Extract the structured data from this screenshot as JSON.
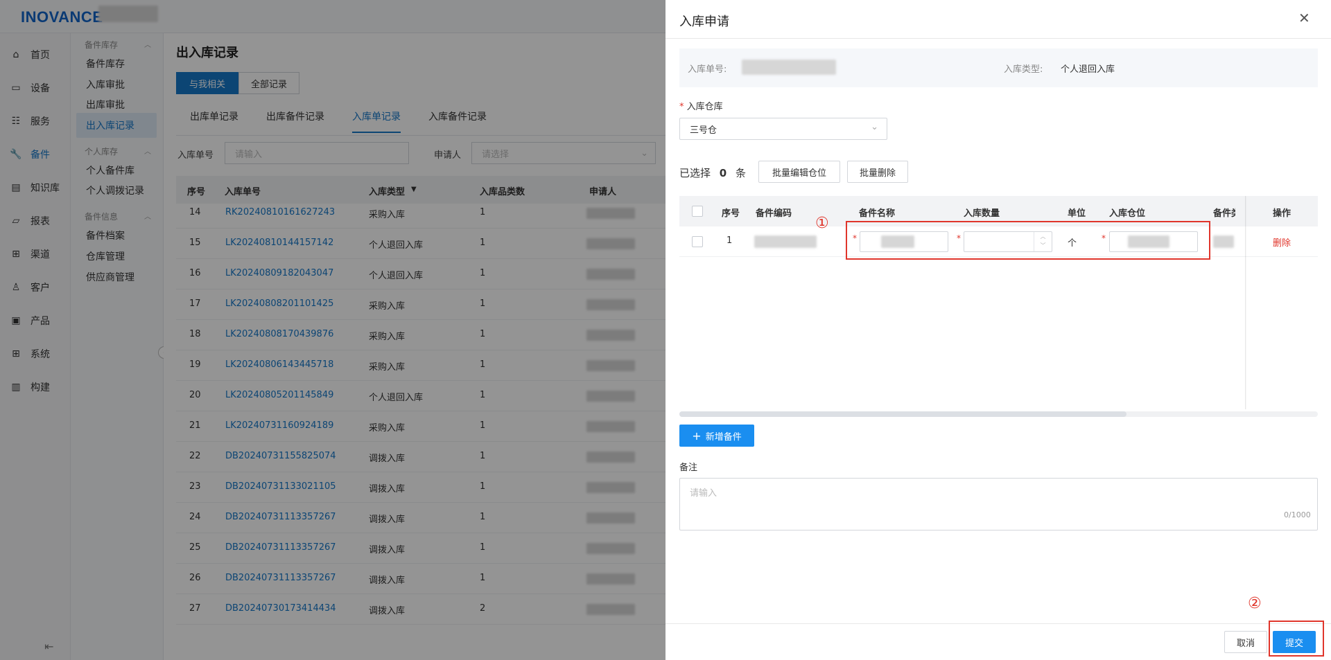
{
  "app": {
    "logo": "INOVANCE"
  },
  "nav_main": [
    {
      "label": "首页",
      "icon": "home-icon",
      "active": false
    },
    {
      "label": "设备",
      "icon": "device-icon",
      "active": false
    },
    {
      "label": "服务",
      "icon": "service-icon",
      "active": false
    },
    {
      "label": "备件",
      "icon": "wrench-icon",
      "active": true
    },
    {
      "label": "知识库",
      "icon": "book-icon",
      "active": false
    },
    {
      "label": "报表",
      "icon": "chart-icon",
      "active": false
    },
    {
      "label": "渠道",
      "icon": "channel-icon",
      "active": false
    },
    {
      "label": "客户",
      "icon": "user-icon",
      "active": false
    },
    {
      "label": "产品",
      "icon": "product-icon",
      "active": false
    },
    {
      "label": "系统",
      "icon": "grid-icon",
      "active": false
    },
    {
      "label": "构建",
      "icon": "build-icon",
      "active": false
    }
  ],
  "nav_sub": {
    "group1": "备件库存",
    "group1_items": [
      "备件库存",
      "入库审批",
      "出库审批",
      "出入库记录"
    ],
    "group2": "个人库存",
    "group2_items": [
      "个人备件库",
      "个人调拨记录"
    ],
    "group3": "备件信息",
    "group3_items": [
      "备件档案",
      "仓库管理",
      "供应商管理"
    ]
  },
  "page": {
    "title": "出入库记录",
    "seg_mine": "与我相关",
    "seg_all": "全部记录",
    "tabs": [
      "出库单记录",
      "出库备件记录",
      "入库单记录",
      "入库备件记录"
    ],
    "active_tab": 2,
    "filter_order_label": "入库单号",
    "filter_order_placeholder": "请输入",
    "filter_applicant_label": "申请人",
    "filter_applicant_placeholder": "请选择"
  },
  "table": {
    "headers": [
      "序号",
      "入库单号",
      "入库类型",
      "入库品类数",
      "申请人"
    ],
    "rows": [
      {
        "no": "14",
        "order": "RK20240810161627243",
        "type": "采购入库",
        "count": "1"
      },
      {
        "no": "15",
        "order": "LK20240810144157142",
        "type": "个人退回入库",
        "count": "1"
      },
      {
        "no": "16",
        "order": "LK20240809182043047",
        "type": "个人退回入库",
        "count": "1"
      },
      {
        "no": "17",
        "order": "LK20240808201101425",
        "type": "采购入库",
        "count": "1"
      },
      {
        "no": "18",
        "order": "LK20240808170439876",
        "type": "采购入库",
        "count": "1"
      },
      {
        "no": "19",
        "order": "LK20240806143445718",
        "type": "采购入库",
        "count": "1"
      },
      {
        "no": "20",
        "order": "LK20240805201145849",
        "type": "个人退回入库",
        "count": "1"
      },
      {
        "no": "21",
        "order": "LK20240731160924189",
        "type": "采购入库",
        "count": "1"
      },
      {
        "no": "22",
        "order": "DB20240731155825074",
        "type": "调拨入库",
        "count": "1"
      },
      {
        "no": "23",
        "order": "DB20240731133021105",
        "type": "调拨入库",
        "count": "1"
      },
      {
        "no": "24",
        "order": "DB20240731113357267",
        "type": "调拨入库",
        "count": "1"
      },
      {
        "no": "25",
        "order": "DB20240731113357267",
        "type": "调拨入库",
        "count": "1"
      },
      {
        "no": "26",
        "order": "DB20240731113357267",
        "type": "调拨入库",
        "count": "1"
      },
      {
        "no": "27",
        "order": "DB20240730173414434",
        "type": "调拨入库",
        "count": "2"
      }
    ]
  },
  "drawer": {
    "title": "入库申请",
    "order_no_label": "入库单号:",
    "type_label": "入库类型:",
    "type_value": "个人退回入库",
    "warehouse_label": "入库仓库",
    "warehouse_value": "三号仓",
    "selected_prefix": "已选择",
    "selected_count": "0",
    "selected_suffix": "条",
    "batch_edit": "批量编辑仓位",
    "batch_delete": "批量删除",
    "headers": [
      "序号",
      "备件编码",
      "备件名称",
      "入库数量",
      "单位",
      "入库仓位",
      "备件类别",
      "操作"
    ],
    "row": {
      "no": "1",
      "unit": "个",
      "action": "删除"
    },
    "add_button": "新增备件",
    "remark_label": "备注",
    "remark_placeholder": "请输入",
    "remark_counter": "0/1000",
    "cancel": "取消",
    "submit": "提交"
  },
  "annotations": {
    "marker1": "①",
    "marker2": "②"
  },
  "colors": {
    "primary": "#1677c8",
    "button": "#1a8ef0",
    "danger": "#e0352b"
  }
}
